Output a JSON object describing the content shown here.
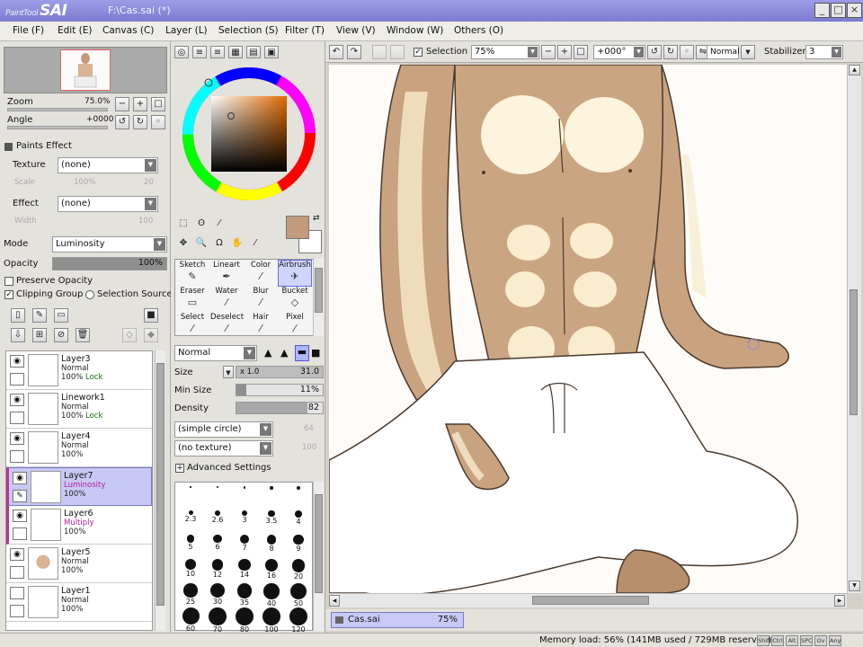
{
  "title": {
    "logo_prefix": "PaintTool",
    "logo": "SAI",
    "file": "F:\\Cas.sai (*)"
  },
  "window_controls": {
    "minimize": "_",
    "maximize": "□",
    "close": "×"
  },
  "menu": [
    "File (F)",
    "Edit (E)",
    "Canvas (C)",
    "Layer (L)",
    "Selection (S)",
    "Filter (T)",
    "View (V)",
    "Window (W)",
    "Others (O)"
  ],
  "navigator": {
    "zoom_label": "Zoom",
    "zoom_value": "75.0%",
    "angle_label": "Angle",
    "angle_value": "+0000"
  },
  "paints_effect": {
    "header": "Paints Effect",
    "texture_label": "Texture",
    "texture_value": "(none)",
    "texture_sub_left": "Scale",
    "texture_sub_mid": "100%",
    "texture_sub_right": "20",
    "effect_label": "Effect",
    "effect_value": "(none)",
    "effect_sub_left": "Width",
    "effect_sub_right": "100"
  },
  "layer_props": {
    "mode_label": "Mode",
    "mode_value": "Luminosity",
    "opacity_label": "Opacity",
    "opacity_value": "100%",
    "opacity_fraction": 1.0,
    "preserve_opacity": "Preserve Opacity",
    "clipping_group": "Clipping Group",
    "selection_source": "Selection Source"
  },
  "layers": [
    {
      "name": "Layer3",
      "mode": "Normal",
      "opacity": "100%",
      "lock": "Lock",
      "selected": false,
      "pink": false
    },
    {
      "name": "Linework1",
      "mode": "Normal",
      "opacity": "100%",
      "lock": "Lock",
      "selected": false,
      "pink": false
    },
    {
      "name": "Layer4",
      "mode": "Normal",
      "opacity": "100%",
      "lock": "",
      "selected": false,
      "pink": false
    },
    {
      "name": "Layer7",
      "mode": "Luminosity",
      "opacity": "100%",
      "lock": "",
      "selected": true,
      "pink": true
    },
    {
      "name": "Layer6",
      "mode": "Multiply",
      "opacity": "100%",
      "lock": "",
      "selected": false,
      "pink": true
    },
    {
      "name": "Layer5",
      "mode": "Normal",
      "opacity": "100%",
      "lock": "",
      "selected": false,
      "pink": false
    },
    {
      "name": "Layer1",
      "mode": "Normal",
      "opacity": "100%",
      "lock": "",
      "selected": false,
      "pink": false
    }
  ],
  "colors": {
    "primary": "#c49a7c",
    "secondary": "#ffffff",
    "selected_layer": "#c8c8f4",
    "title_bar": "#8c8cdc"
  },
  "tools": [
    {
      "label": "Sketch",
      "icon": "pencil-icon"
    },
    {
      "label": "Lineart",
      "icon": "pen-icon"
    },
    {
      "label": "Color",
      "icon": "brush-icon"
    },
    {
      "label": "Airbrush",
      "icon": "airbrush-icon",
      "active": true
    },
    {
      "label": "Eraser",
      "icon": "eraser-icon"
    },
    {
      "label": "Water",
      "icon": "water-brush-icon"
    },
    {
      "label": "Blur",
      "icon": "blur-icon"
    },
    {
      "label": "Bucket",
      "icon": "bucket-icon"
    },
    {
      "label": "Select",
      "icon": "select-icon"
    },
    {
      "label": "Deselect",
      "icon": "deselect-icon"
    },
    {
      "label": "Hair",
      "icon": "hair-icon"
    },
    {
      "label": "Pixel",
      "icon": "pixel-icon"
    }
  ],
  "brush": {
    "mode_value": "Normal",
    "size_label": "Size",
    "size_mult": "x 1.0",
    "size_value": "31.0",
    "min_size_label": "Min Size",
    "min_size_value": "11%",
    "min_size_fraction": 0.11,
    "density_label": "Density",
    "density_value": "82",
    "density_fraction": 0.82,
    "shape_value": "(simple circle)",
    "shape_num": "64",
    "texture_value": "(no texture)",
    "texture_num": "100",
    "advanced": "Advanced Settings",
    "presets": [
      [
        "•",
        "•",
        "•",
        "•",
        "•"
      ],
      [
        "2.3",
        "2.6",
        "3",
        "3.5",
        "4"
      ],
      [
        "5",
        "6",
        "7",
        "8",
        "9"
      ],
      [
        "10",
        "12",
        "14",
        "16",
        "20"
      ],
      [
        "25",
        "30",
        "35",
        "40",
        "50"
      ],
      [
        "60",
        "70",
        "80",
        "100",
        "120"
      ]
    ]
  },
  "canvas_toolbar": {
    "selection_label": "Selection",
    "zoom_value": "75%",
    "angle_value": "+000°",
    "blend_value": "Normal",
    "stabilizer_label": "Stabilizer",
    "stabilizer_value": "3"
  },
  "tab": {
    "name": "Cas.sai",
    "zoom": "75%"
  },
  "status": {
    "memory": "Memory load: 56% (141MB used / 729MB reserved)",
    "keys": [
      "Shift",
      "Ctrl",
      "Alt",
      "SPC",
      "Ov",
      "Any"
    ]
  }
}
